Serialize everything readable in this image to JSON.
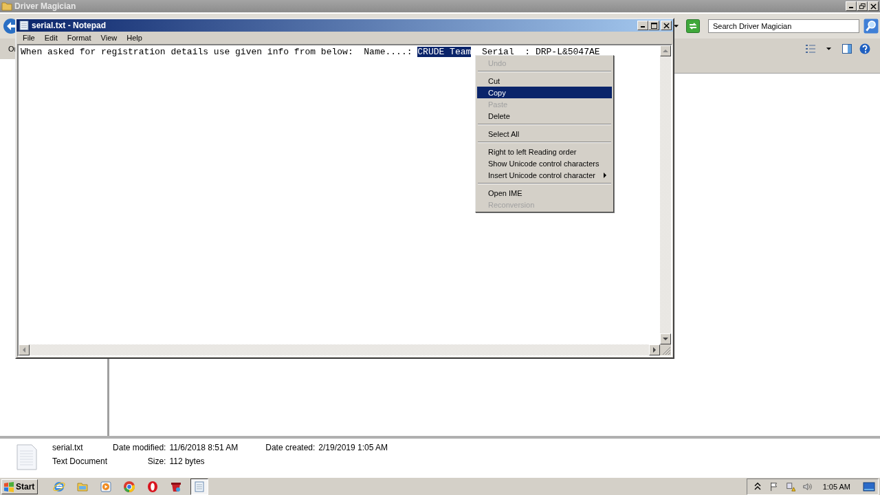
{
  "explorer": {
    "title": "Driver Magician",
    "toolbar_text": "Or",
    "search": {
      "placeholder": "Search Driver Magician"
    }
  },
  "notepad": {
    "title": "serial.txt - Notepad",
    "menu": [
      "File",
      "Edit",
      "Format",
      "View",
      "Help"
    ],
    "text": {
      "before": "When asked for registration details use given info from below:  Name....: ",
      "selection": "CRUDE Team",
      "after": "  Serial  : DRP-L&5047AE"
    }
  },
  "context_menu": [
    {
      "kind": "item",
      "label": "Undo",
      "disabled": true,
      "selected": false,
      "submenu": false
    },
    {
      "kind": "separator"
    },
    {
      "kind": "item",
      "label": "Cut",
      "disabled": false,
      "selected": false,
      "submenu": false
    },
    {
      "kind": "item",
      "label": "Copy",
      "disabled": false,
      "selected": true,
      "submenu": false
    },
    {
      "kind": "item",
      "label": "Paste",
      "disabled": true,
      "selected": false,
      "submenu": false
    },
    {
      "kind": "item",
      "label": "Delete",
      "disabled": false,
      "selected": false,
      "submenu": false
    },
    {
      "kind": "separator"
    },
    {
      "kind": "item",
      "label": "Select All",
      "disabled": false,
      "selected": false,
      "submenu": false
    },
    {
      "kind": "separator"
    },
    {
      "kind": "item",
      "label": "Right to left Reading order",
      "disabled": false,
      "selected": false,
      "submenu": false
    },
    {
      "kind": "item",
      "label": "Show Unicode control characters",
      "disabled": false,
      "selected": false,
      "submenu": false
    },
    {
      "kind": "item",
      "label": "Insert Unicode control character",
      "disabled": false,
      "selected": false,
      "submenu": true
    },
    {
      "kind": "separator"
    },
    {
      "kind": "item",
      "label": "Open IME",
      "disabled": false,
      "selected": false,
      "submenu": false
    },
    {
      "kind": "item",
      "label": "Reconversion",
      "disabled": true,
      "selected": false,
      "submenu": false
    }
  ],
  "details": {
    "file_name": "serial.txt",
    "file_type": "Text Document",
    "columns": [
      [
        {
          "label": "Date modified:",
          "value": "11/6/2018 8:51 AM"
        },
        {
          "label": "Size:",
          "value": "112 bytes"
        }
      ],
      [
        {
          "label": "Date created:",
          "value": "2/19/2019 1:05 AM"
        }
      ]
    ]
  },
  "taskbar": {
    "start": "Start",
    "apps": [
      {
        "kind": "ie",
        "selected": false
      },
      {
        "kind": "explorer",
        "selected": false
      },
      {
        "kind": "media",
        "selected": false
      },
      {
        "kind": "chrome",
        "selected": false
      },
      {
        "kind": "opera",
        "selected": false
      },
      {
        "kind": "app",
        "selected": false
      },
      {
        "kind": "notepad",
        "selected": true
      }
    ],
    "clock": "1:05 AM"
  }
}
